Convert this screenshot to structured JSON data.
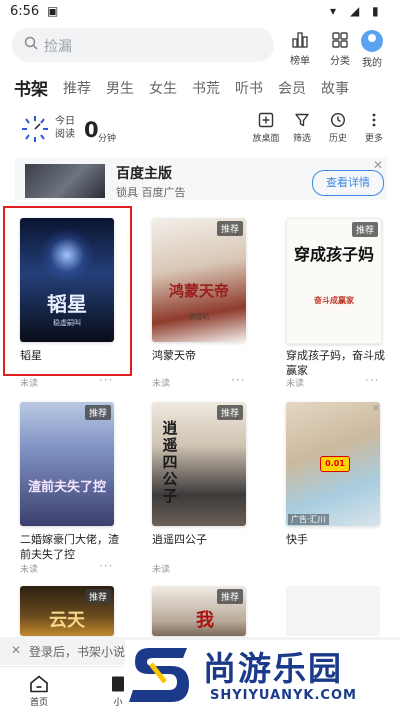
{
  "status": {
    "time": "6:56",
    "signal": "▾◢",
    "battery": "▮"
  },
  "search": {
    "placeholder": "捡漏"
  },
  "top_buttons": [
    {
      "label": "榜单"
    },
    {
      "label": "分类"
    },
    {
      "label": "我的"
    }
  ],
  "tabs": [
    "书架",
    "推荐",
    "男生",
    "女生",
    "书荒",
    "听书",
    "会员",
    "故事"
  ],
  "reading": {
    "today_label": "今日",
    "read_label": "阅读",
    "minutes": "0",
    "unit": "分钟"
  },
  "tools": [
    {
      "label": "放桌面"
    },
    {
      "label": "筛选"
    },
    {
      "label": "历史"
    },
    {
      "label": "更多"
    }
  ],
  "ad": {
    "title": "百度主版",
    "subtitle": "锁具 百度广告",
    "button": "查看详情",
    "close": "✕"
  },
  "books": [
    {
      "title": "韬星",
      "status": "未读",
      "cover_text": "韬星",
      "author": "稳虚嗣叫",
      "badge": ""
    },
    {
      "title": "鸿蒙天帝",
      "status": "未读",
      "cover_text": "鸿蒙天帝",
      "author": "落雲叭",
      "badge": "推荐"
    },
    {
      "title": "穿成孩子妈，奋斗成赢家",
      "status": "未读",
      "cover_text": "穿成孩子妈",
      "author": "奋斗成赢家",
      "badge": "推荐"
    },
    {
      "title": "二婚嫁豪门大佬，渣前夫失了控",
      "status": "未读",
      "cover_text": "渣前夫失了控",
      "author": "",
      "badge": "推荐"
    },
    {
      "title": "逍遥四公子",
      "status": "未读",
      "cover_text": "逍遥四公子",
      "author": "",
      "badge": "推荐"
    },
    {
      "title": "快手",
      "status": "",
      "cover_text": "广告·汇川",
      "author": "",
      "badge": ""
    }
  ],
  "partial_covers": [
    {
      "badge": "推荐",
      "text": "云天"
    },
    {
      "badge": "推荐",
      "text": "我"
    }
  ],
  "login_banner": {
    "close": "✕",
    "text": "登录后，书架小说"
  },
  "bottom_nav": [
    {
      "label": "首页"
    },
    {
      "label": "小"
    }
  ],
  "watermark": {
    "big": "尚游乐园",
    "small": "SHYIYUANYK.COM"
  },
  "colors": {
    "highlight": "#e02020",
    "accent": "#3e88e0",
    "brand": "#1b3a8a"
  }
}
